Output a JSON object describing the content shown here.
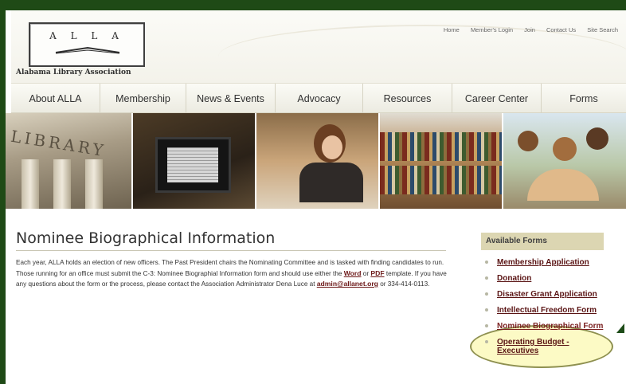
{
  "site": {
    "logo_letters": "A L L A",
    "logo_subtitle": "Alabama Library Association"
  },
  "top_links": [
    "Home",
    "Member's Login",
    "Join",
    "Contact Us",
    "Site Search"
  ],
  "nav": [
    "About ALLA",
    "Membership",
    "News & Events",
    "Advocacy",
    "Resources",
    "Career Center",
    "Forms"
  ],
  "banner": {
    "library_text": "LIBRARY"
  },
  "content": {
    "title": "Nominee Biographical Information",
    "paragraph_part1": "Each year, ALLA holds an election of new officers. The Past President chairs the Nominating Committee and is tasked with finding candidates to run. Those running for an office must submit the C-3: Nominee Biographial Information form and should use either the ",
    "link_word": "Word",
    "paragraph_or": " or ",
    "link_pdf": "PDF",
    "paragraph_part2": " template. If you have any questions about the form or the process, please contact the Association Administrator Dena Luce at ",
    "email": "admin@allanet.org",
    "paragraph_part3": " or 334-414-0113."
  },
  "sidebar": {
    "heading": "Available Forms",
    "items": [
      "Membership Application",
      "Donation",
      "Disaster Grant Application",
      "Intellectual Freedom Form",
      "Nominee Biographical Form",
      "Operating Budget - Executives"
    ]
  },
  "colors": {
    "frame": "#1f4a16",
    "link": "#6b1717",
    "sidebar_heading_bg": "#dcd6b2",
    "highlight": "#faf596"
  }
}
